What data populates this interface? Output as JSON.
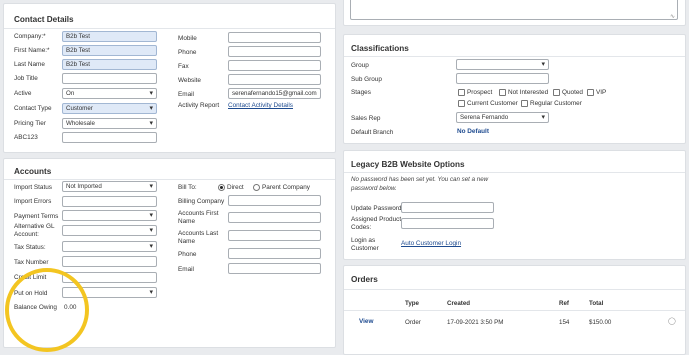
{
  "contact_details": {
    "title": "Contact Details",
    "left_fields": [
      {
        "label": "Company:*",
        "value": "B2b Test"
      },
      {
        "label": "First Name:*",
        "value": "B2b Test"
      },
      {
        "label": "Last Name",
        "value": "B2b Test"
      },
      {
        "label": "Job Title",
        "value": ""
      },
      {
        "label": "Active",
        "value": "On"
      },
      {
        "label": "Contact Type",
        "value": "Customer"
      },
      {
        "label": "Pricing Tier",
        "value": "Wholesale"
      },
      {
        "label": "ABC123",
        "value": ""
      }
    ],
    "right_fields": [
      {
        "label": "Mobile",
        "value": ""
      },
      {
        "label": "Phone",
        "value": ""
      },
      {
        "label": "Fax",
        "value": ""
      },
      {
        "label": "Website",
        "value": ""
      },
      {
        "label": "Email",
        "value": "serenafernando15@gmail.com"
      },
      {
        "label": "Activity Report",
        "value": "Contact Activity Details"
      }
    ]
  },
  "accounts": {
    "title": "Accounts",
    "left_fields": [
      {
        "label": "Import Status",
        "value": "Not Imported"
      },
      {
        "label": "Import Errors",
        "value": ""
      },
      {
        "label": "Payment Terms",
        "value": ""
      },
      {
        "label": "Alternative GL Account:",
        "value": ""
      },
      {
        "label": "Tax Status:",
        "value": ""
      },
      {
        "label": "Tax Number",
        "value": ""
      },
      {
        "label": "Credit Limit",
        "value": ""
      },
      {
        "label": "Put on Hold",
        "value": ""
      },
      {
        "label": "Balance Owing",
        "value": "0.00"
      }
    ],
    "bill_to": {
      "label": "Bill To:",
      "option_direct": "Direct",
      "option_parent": "Parent Company"
    },
    "right_fields": [
      {
        "label": "Billing Company",
        "value": ""
      },
      {
        "label": "Accounts First Name",
        "value": ""
      },
      {
        "label": "Accounts Last Name",
        "value": ""
      },
      {
        "label": "Phone",
        "value": ""
      },
      {
        "label": "Email",
        "value": ""
      }
    ]
  },
  "classifications": {
    "title": "Classifications",
    "group_label": "Group",
    "subgroup_label": "Sub Group",
    "stages_label": "Stages",
    "stages": [
      "Prospect",
      "Not Interested",
      "Quoted",
      "VIP",
      "Current Customer",
      "Regular Customer"
    ],
    "sales_rep_label": "Sales Rep",
    "sales_rep_value": "Serena Fernando",
    "default_branch_label": "Default Branch",
    "default_branch_value": "No Default"
  },
  "legacy": {
    "title": "Legacy B2B Website Options",
    "note": "No password has been set yet. You can set a new password below.",
    "update_password_label": "Update Password",
    "assigned_codes_label": "Assigned Product Codes:",
    "login_as_label": "Login as Customer",
    "login_link": "Auto Customer Login"
  },
  "orders": {
    "title": "Orders",
    "headers": [
      "Type",
      "Created",
      "Ref",
      "Total"
    ],
    "rows": [
      {
        "action": "View",
        "type": "Order",
        "created": "17-09-2021 3:50 PM",
        "ref": "154",
        "total": "$150.00"
      }
    ]
  },
  "colors": {
    "highlight": "#f3c521",
    "link": "#1d4a8f",
    "required_field": "#dfe9f7"
  }
}
